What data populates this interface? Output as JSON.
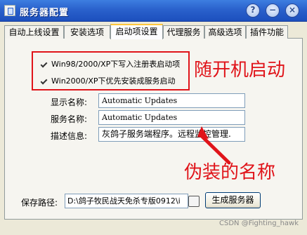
{
  "window": {
    "title": "服务器配置",
    "controls": [
      "?",
      "−",
      "×"
    ]
  },
  "tabs": [
    {
      "label": "自动上线设置",
      "active": false
    },
    {
      "label": "安装选项",
      "active": false
    },
    {
      "label": "启动项设置",
      "active": true
    },
    {
      "label": "代理服务",
      "active": false
    },
    {
      "label": "高级选项",
      "active": false
    },
    {
      "label": "插件功能",
      "active": false
    }
  ],
  "options": [
    {
      "label": "Win98/2000/XP下写入注册表启动项",
      "checked": true
    },
    {
      "label": "Win2000/XP下优先安装成服务启动",
      "checked": true
    }
  ],
  "fields": {
    "display_name": {
      "label": "显示名称:",
      "value": "Automatic Updates"
    },
    "service_name": {
      "label": "服务名称:",
      "value": "Automatic Updates"
    },
    "description": {
      "label": "描述信息:",
      "value": "灰鸽子服务端程序。远程监控管理."
    }
  },
  "annotations": {
    "autostart": "随开机启动",
    "disguise": "伪装的名称"
  },
  "save_path": {
    "label": "保存路径:",
    "value": "D:\\鸽子牧民战天免杀专版0912\\i"
  },
  "generate_button": "生成服务器",
  "watermark": "CSDN @Fighting_hawk",
  "colors": {
    "annotation_red": "#e0141a",
    "titlebar_blue": "#2a61cc",
    "active_tab_accent": "#ffc73c"
  },
  "icons": [
    "app-icon",
    "help-icon",
    "minimize-icon",
    "close-icon",
    "checkbox-checked-icon",
    "arrow-icon",
    "folder-browse-icon"
  ]
}
